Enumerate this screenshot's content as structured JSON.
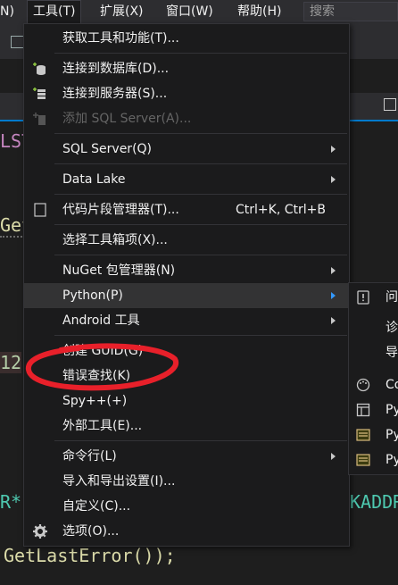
{
  "menubar": {
    "partial_left": "N)",
    "tools": "工具(T)",
    "extensions": "扩展(X)",
    "window": "窗口(W)",
    "help": "帮助(H)",
    "search": "搜索"
  },
  "tools_menu": {
    "get_tools": "获取工具和功能(T)...",
    "connect_db": "连接到数据库(D)...",
    "connect_server": "连接到服务器(S)...",
    "add_sql_server": "添加 SQL Server(A)...",
    "sql_server": "SQL Server(Q)",
    "data_lake": "Data Lake",
    "snippets": "代码片段管理器(T)...",
    "snippets_shortcut": "Ctrl+K, Ctrl+B",
    "choose_toolbox": "选择工具箱项(X)...",
    "nuget": "NuGet 包管理器(N)",
    "python": "Python(P)",
    "android": "Android 工具",
    "create_guid": "创建 GUID(G)",
    "error_lookup": "错误查找(K)",
    "spy": "Spy++(+)",
    "external_tools": "外部工具(E)...",
    "command_line": "命令行(L)",
    "import_export": "导入和导出设置(I)...",
    "customize": "自定义(C)...",
    "options": "选项(O)..."
  },
  "python_submenu": [
    "问",
    "诊",
    "导",
    "Co",
    "Py",
    "Py",
    "Py"
  ],
  "code": {
    "l1": "LST",
    "l2": "Get",
    "l3": "12",
    "l4": "R*",
    "l4b": "KADDR",
    "l5": "GetLastError());"
  },
  "colors": {
    "accent": "#007acc",
    "annotation": "#e8202a",
    "menu_bg": "#1b1b1c"
  }
}
